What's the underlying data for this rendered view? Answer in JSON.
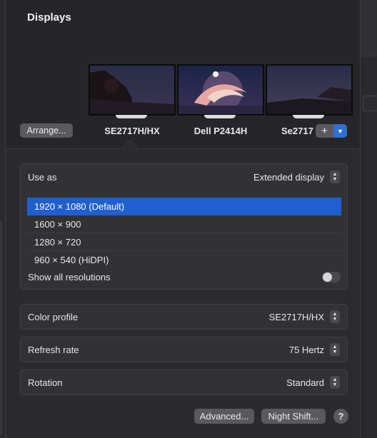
{
  "window": {
    "title": "Displays"
  },
  "toolbar": {
    "arrange_label": "Arrange...",
    "add_label": "+",
    "add_menu_label": "⌄"
  },
  "monitors": [
    {
      "name": "SE2717H/HX",
      "selected": true
    },
    {
      "name": "Dell P2414H",
      "selected": false
    },
    {
      "name": "Se2717",
      "selected": false
    }
  ],
  "use_as": {
    "label": "Use as",
    "value": "Extended display"
  },
  "resolutions": {
    "items": [
      "1920 × 1080 (Default)",
      "1600 × 900",
      "1280 × 720",
      "960 × 540 (HiDPI)"
    ],
    "selected": "1920 × 1080 (Default)",
    "show_all_label": "Show all resolutions",
    "show_all_on": false
  },
  "color_profile": {
    "label": "Color profile",
    "value": "SE2717H/HX"
  },
  "refresh_rate": {
    "label": "Refresh rate",
    "value": "75 Hertz"
  },
  "rotation": {
    "label": "Rotation",
    "value": "Standard"
  },
  "footer": {
    "advanced_label": "Advanced...",
    "night_shift_label": "Night Shift...",
    "help_label": "?"
  },
  "colors": {
    "accent": "#1f5fcf",
    "panel": "#2b2b2d",
    "card": "#323234"
  }
}
